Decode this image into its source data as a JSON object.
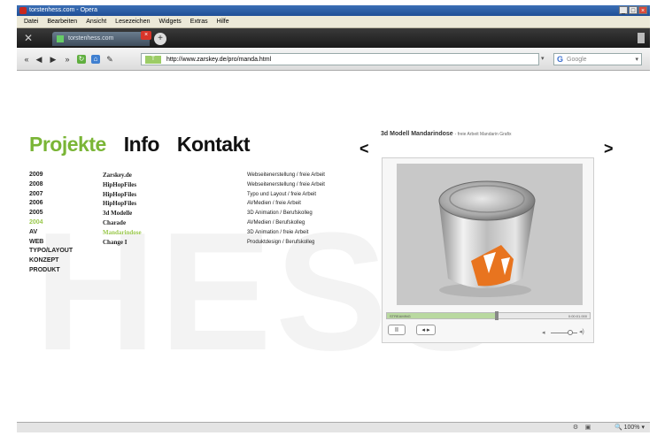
{
  "window": {
    "title": "torstenhess.com - Opera"
  },
  "menubar": [
    "Datei",
    "Bearbeiten",
    "Ansicht",
    "Lesezeichen",
    "Widgets",
    "Extras",
    "Hilfe"
  ],
  "tabs": {
    "active_tab_label": "torstenhess.com"
  },
  "navbar": {
    "url": "http://www.zarskey.de/pro/manda.html",
    "search_placeholder": "Google"
  },
  "page": {
    "watermark": "HESS",
    "nav": {
      "projekte": "Projekte",
      "info": "Info",
      "kontakt": "Kontakt"
    },
    "years": [
      "2009",
      "2008",
      "2007",
      "2006",
      "2005",
      "2004",
      "AV",
      "WEB",
      "TYPO/LAYOUT",
      "KONZEPT",
      "PRODUKT"
    ],
    "highlight_year_index": 5,
    "projects": [
      "Zarskey.de",
      "HipHopFiles",
      "HipHopFiles",
      "HipHopFiles",
      "3d Modelle",
      "Charade",
      "Mandarindose",
      "Change I"
    ],
    "highlight_project_index": 6,
    "descriptions": [
      "Webseitenerstellung / freie Arbeit",
      "Webseitenerstellung / freie Arbeit",
      "Typo und Layout / freie Arbeit",
      "AVMedien / freie Arbeit",
      "3D Animation / Berufskolleg",
      "AVMedien / Berufskolleg",
      "3D Animation / freie Arbeit",
      "Produktdesign / Berufskolleg"
    ],
    "model_title": "3d Modell Mandarindose",
    "model_subtitle": "- freie Arbeit Mandarin Grafix",
    "prev_arrow": "<",
    "next_arrow": ">"
  },
  "player": {
    "status": "STREAMING",
    "time": "0:00:01.000",
    "progress": 0.54,
    "volume": 0.73,
    "pause_label": "II",
    "seek_label": "◂·▸"
  },
  "statusbar": {
    "zoom": "100%"
  },
  "colors": {
    "accent_green": "#7ab536",
    "highlight_green": "#9ac84c",
    "can_orange": "#e8741f"
  }
}
